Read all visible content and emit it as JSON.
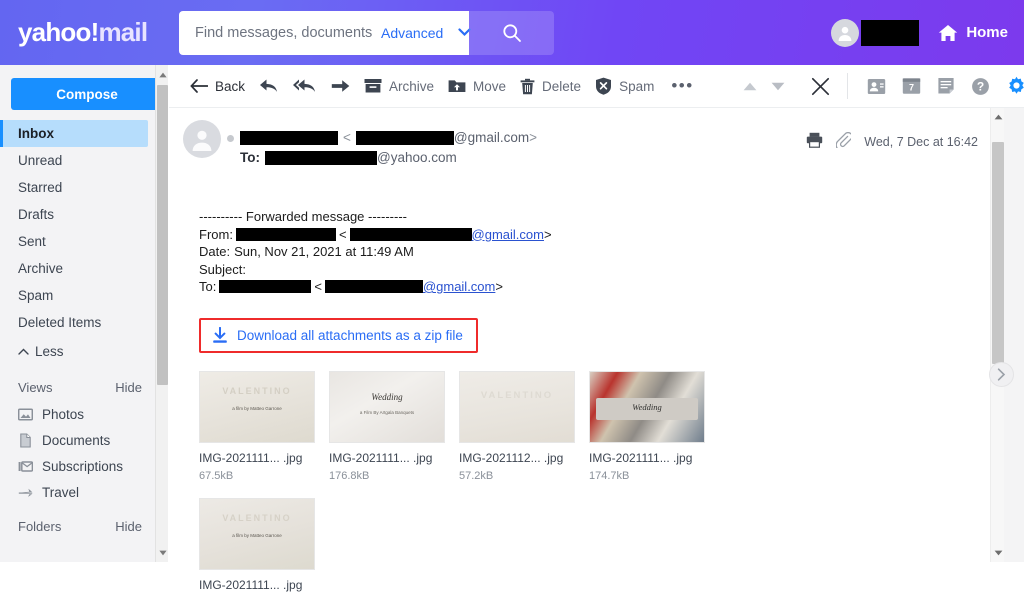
{
  "header": {
    "brand": {
      "yahoo": "yahoo",
      "bang": "!",
      "mail": "mail"
    },
    "search": {
      "placeholder": "Find messages, documents, photos or peo",
      "value": "",
      "advanced_label": "Advanced",
      "caret_icon": "chevron-down-icon",
      "search_icon": "search-icon"
    },
    "account": {
      "avatar_icon": "user-avatar-icon",
      "name_redacted": true
    },
    "home": {
      "label": "Home",
      "icon": "home-icon"
    }
  },
  "sidebar": {
    "compose_label": "Compose",
    "folders": [
      {
        "label": "Inbox",
        "active": true
      },
      {
        "label": "Unread",
        "active": false
      },
      {
        "label": "Starred",
        "active": false
      },
      {
        "label": "Drafts",
        "active": false
      },
      {
        "label": "Sent",
        "active": false
      },
      {
        "label": "Archive",
        "active": false
      },
      {
        "label": "Spam",
        "active": false
      },
      {
        "label": "Deleted Items",
        "active": false
      }
    ],
    "less_label": "Less",
    "less_icon": "chevron-up-icon",
    "views_section": {
      "title": "Views",
      "hide_label": "Hide",
      "items": [
        {
          "label": "Photos",
          "icon": "photo-icon"
        },
        {
          "label": "Documents",
          "icon": "document-icon"
        },
        {
          "label": "Subscriptions",
          "icon": "subscriptions-icon"
        },
        {
          "label": "Travel",
          "icon": "airplane-icon"
        }
      ]
    },
    "folders_section": {
      "title": "Folders",
      "hide_label": "Hide"
    }
  },
  "toolbar": {
    "back_label": "Back",
    "back_icon": "arrow-left-icon",
    "reply_icon": "reply-icon",
    "reply_all_icon": "reply-all-icon",
    "forward_icon": "forward-icon",
    "archive_label": "Archive",
    "archive_icon": "archive-icon",
    "move_label": "Move",
    "move_icon": "move-folder-icon",
    "delete_label": "Delete",
    "delete_icon": "trash-icon",
    "spam_label": "Spam",
    "spam_icon": "spam-shield-icon",
    "more_label": "•••",
    "prev_icon": "triangle-up-icon",
    "next_icon": "triangle-down-icon",
    "close_icon": "close-x-icon",
    "apps": [
      {
        "name": "contacts-icon"
      },
      {
        "name": "calendar-icon",
        "badge": "7"
      },
      {
        "name": "notepad-icon"
      },
      {
        "name": "help-icon"
      },
      {
        "name": "settings-gear-icon"
      }
    ]
  },
  "message": {
    "avatar_icon": "user-avatar-icon",
    "unread_dot": true,
    "from_name_redacted": true,
    "from_email_domain": "@gmail.com",
    "bracket_open": "<",
    "bracket_close": ">",
    "to_label": "To:",
    "to_email_domain": "@yahoo.com",
    "print_icon": "printer-icon",
    "attachment_icon": "paperclip-icon",
    "date": "Wed, 7 Dec at 16:42",
    "star_icon": "star-outline-icon"
  },
  "forwarded": {
    "divider_left": "---------- Forwarded message ---------",
    "from_label": "From:",
    "from_domain": "@gmail.com",
    "date_label": "Date:",
    "date_value": "Sun, Nov 21, 2021 at 11:49 AM",
    "subject_label": "Subject:",
    "subject_value": "",
    "to_label": "To:",
    "to_domain": "@gmail.com",
    "bracket_open": "<",
    "bracket_close": ">"
  },
  "download_all": {
    "label": "Download all attachments as a zip file",
    "icon": "download-icon",
    "highlight_color": "#ef2b2b",
    "link_color": "#2a6df5"
  },
  "attachments": [
    {
      "name": "IMG-2021111... .jpg",
      "size": "67.5kB",
      "thumb_caption": "VALENTINO",
      "thumb_sub": "a film by Matteo Garrone",
      "thumb_style": "cream-card"
    },
    {
      "name": "IMG-2021111... .jpg",
      "size": "176.8kB",
      "thumb_caption": "Wedding",
      "thumb_sub": "a Film By Artgala Banquets",
      "thumb_style": "script-card"
    },
    {
      "name": "IMG-2021112... .jpg",
      "size": "57.2kB",
      "thumb_caption": "VALENTINO",
      "thumb_sub": "",
      "thumb_style": "embossed-card"
    },
    {
      "name": "IMG-2021111... .jpg",
      "size": "174.7kB",
      "thumb_caption": "Wedding",
      "thumb_sub": "",
      "thumb_style": "photo-card"
    },
    {
      "name": "IMG-2021111... .jpg",
      "size": "",
      "thumb_caption": "VALENTINO",
      "thumb_sub": "a film by Matteo Garrone",
      "thumb_style": "cream-card"
    }
  ],
  "scrollbars": {
    "sidebar_up_icon": "scroll-up-icon",
    "sidebar_down_icon": "scroll-down-icon",
    "main_up_icon": "scroll-up-icon",
    "main_down_icon": "scroll-down-icon",
    "expand_icon": "chevron-right-icon"
  },
  "colors": {
    "header_gradient_start": "#6366f1",
    "header_gradient_end": "#7c3aed",
    "compose_blue": "#188fff",
    "active_folder": "#b6ddfc",
    "link_blue": "#2a6df5",
    "highlight_red": "#ef2b2b"
  }
}
